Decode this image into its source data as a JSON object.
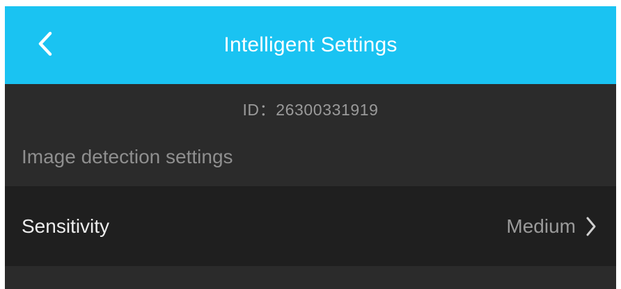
{
  "header": {
    "title": "Intelligent Settings",
    "back_icon": "chevron-left-icon",
    "background": "#1ac3f2"
  },
  "device": {
    "id_text": "ID：26300331919"
  },
  "section": {
    "title": "Image detection settings"
  },
  "rows": [
    {
      "label": "Sensitivity",
      "value": "Medium",
      "icon": "chevron-right-icon"
    }
  ],
  "colors": {
    "background": "#2b2b2b",
    "row_background": "#1f1f1f",
    "accent": "#1ac3f2"
  }
}
